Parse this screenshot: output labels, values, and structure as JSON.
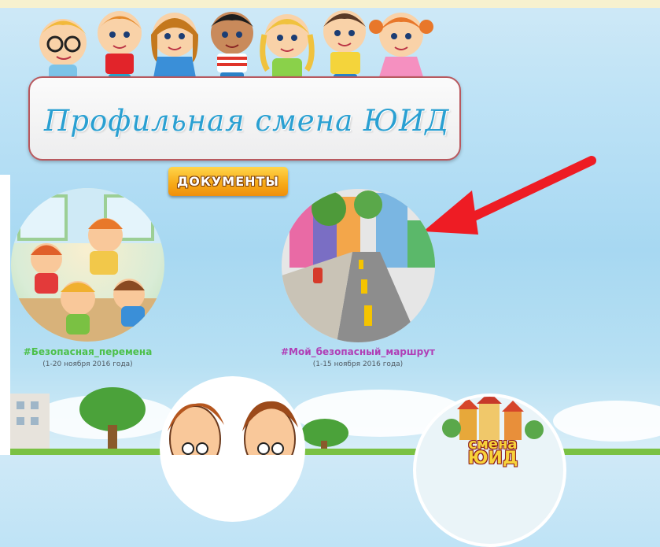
{
  "banner": {
    "title": "Профильная смена ЮИД"
  },
  "docs_button": {
    "label": "ДОКУМЕНТЫ"
  },
  "cards": [
    {
      "title": "#Безопасная_перемена",
      "date": "(1-20 ноября 2016 года)",
      "title_color": "#4cc04a"
    },
    {
      "title": "#Мой_безопасный_маршрут",
      "date": "(1-15 ноября 2016 года)",
      "title_color": "#b03fb6"
    }
  ],
  "logo": {
    "line1": "смена",
    "line2": "ЮИД"
  },
  "colors": {
    "arrow": "#ee1c24",
    "title_blue": "#2aa0d2",
    "button_orange": "#f7a916"
  },
  "icons": [
    "pointer-arrow-icon"
  ]
}
